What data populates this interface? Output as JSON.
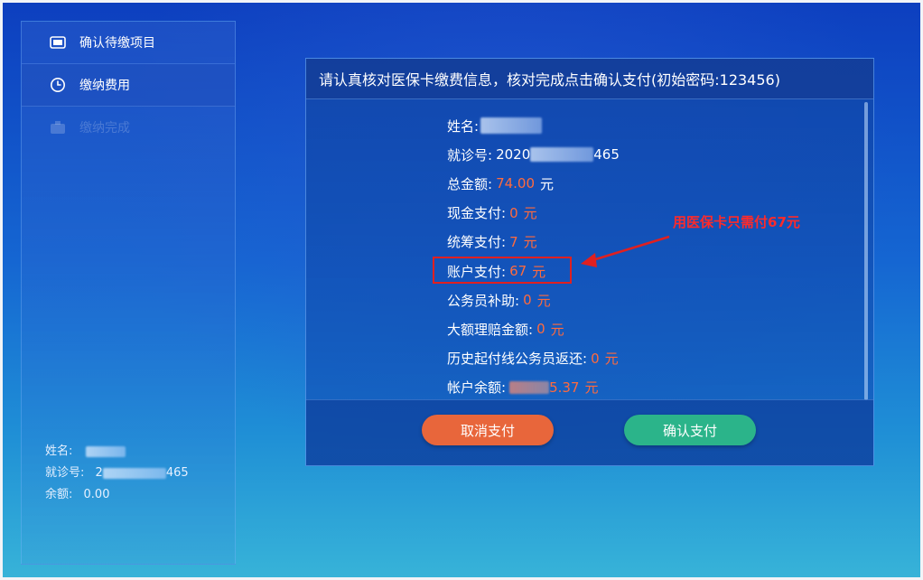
{
  "sidebar": {
    "items": [
      {
        "label": "确认待缴项目",
        "icon": "card-icon",
        "state": "normal"
      },
      {
        "label": "缴纳费用",
        "icon": "clock-icon",
        "state": "active"
      },
      {
        "label": "缴纳完成",
        "icon": "camera-icon",
        "state": "disabled"
      }
    ],
    "info": {
      "name_label": "姓名:",
      "visit_label": "就诊号:",
      "visit_prefix": "2",
      "visit_suffix": "465",
      "balance_label": "余额:",
      "balance_value": "0.00"
    }
  },
  "panel": {
    "header": "请认真核对医保卡缴费信息，核对完成点击确认支付(初始密码:123456)",
    "rows": {
      "name": {
        "label": "姓名:"
      },
      "visit": {
        "label": "就诊号:",
        "prefix": "2020",
        "suffix": "465"
      },
      "total": {
        "label": "总金额:",
        "value": "74.00",
        "unit": "元"
      },
      "cash": {
        "label": "现金支付:",
        "value": "0",
        "unit": "元"
      },
      "pooled": {
        "label": "统筹支付:",
        "value": "7",
        "unit": "元"
      },
      "account": {
        "label": "账户支付:",
        "value": "67",
        "unit": "元"
      },
      "civil_subsidy": {
        "label": "公务员补助:",
        "value": "0",
        "unit": "元"
      },
      "large_claim": {
        "label": "大额理赔金额:",
        "value": "0",
        "unit": "元"
      },
      "civil_refund": {
        "label": "历史起付线公务员返还:",
        "value": "0",
        "unit": "元"
      },
      "account_balance": {
        "label": "帐户余额:",
        "suffix": "5.37",
        "unit": "元"
      }
    },
    "buttons": {
      "cancel": "取消支付",
      "confirm": "确认支付"
    }
  },
  "annotation": {
    "callout": "用医保卡只需付67元",
    "color": "#e02020"
  },
  "colors": {
    "value": "#ff6a3d",
    "cancel": "#e8663b",
    "confirm": "#2bb48a"
  }
}
